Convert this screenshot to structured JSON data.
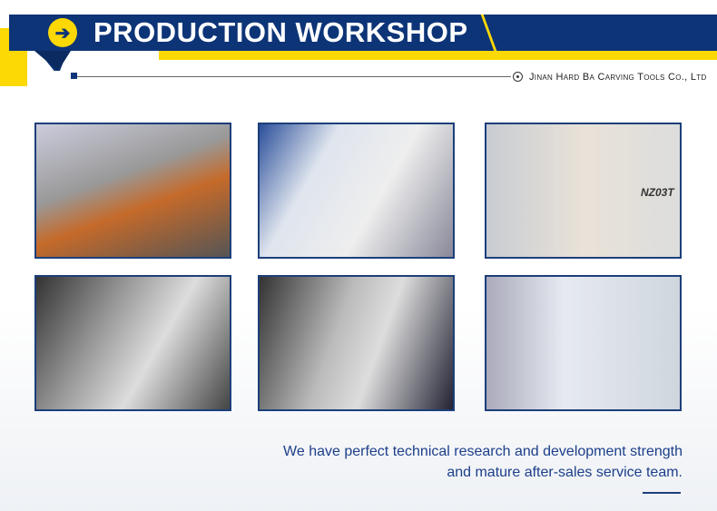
{
  "header": {
    "title": "PRODUCTION WORKSHOP",
    "arrow_icon": "arrow-right-circle-icon",
    "company": "Jinan Hard Ba Carving Tools Co., Ltd"
  },
  "photos": [
    "cnc-tool-grinding",
    "cnc-machine-row",
    "operator-at-nz03t-machine",
    "tool-grinding-closeup",
    "inspection-workstation",
    "five-axis-grinder"
  ],
  "photo_label": "NZ03T",
  "caption": {
    "line1": "We have perfect technical research and development strength",
    "line2": "and mature after-sales service team."
  },
  "colors": {
    "blue": "#0d3477",
    "yellow": "#fcd804",
    "caption": "#1d3f8a"
  }
}
